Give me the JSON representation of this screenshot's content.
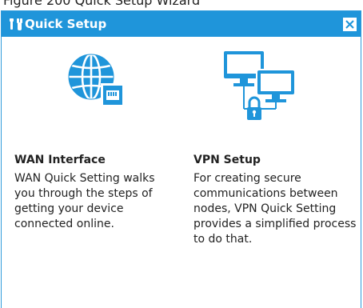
{
  "header_fragment": "Figure 200   Quick Setup Wizard",
  "dialog": {
    "title": "Quick Setup",
    "title_icon": "tools-icon",
    "close_icon": "close-icon",
    "colors": {
      "titlebar": "#1f95da",
      "accent": "#1f95da"
    }
  },
  "cards": [
    {
      "icon": "globe-network-icon",
      "title": "WAN Interface",
      "description": "WAN Quick Setting walks you through the steps of getting your device connected online."
    },
    {
      "icon": "vpn-computers-lock-icon",
      "title": "VPN Setup",
      "description": "For creating secure communications between nodes, VPN Quick Setting provides a simplified process to do that."
    }
  ]
}
